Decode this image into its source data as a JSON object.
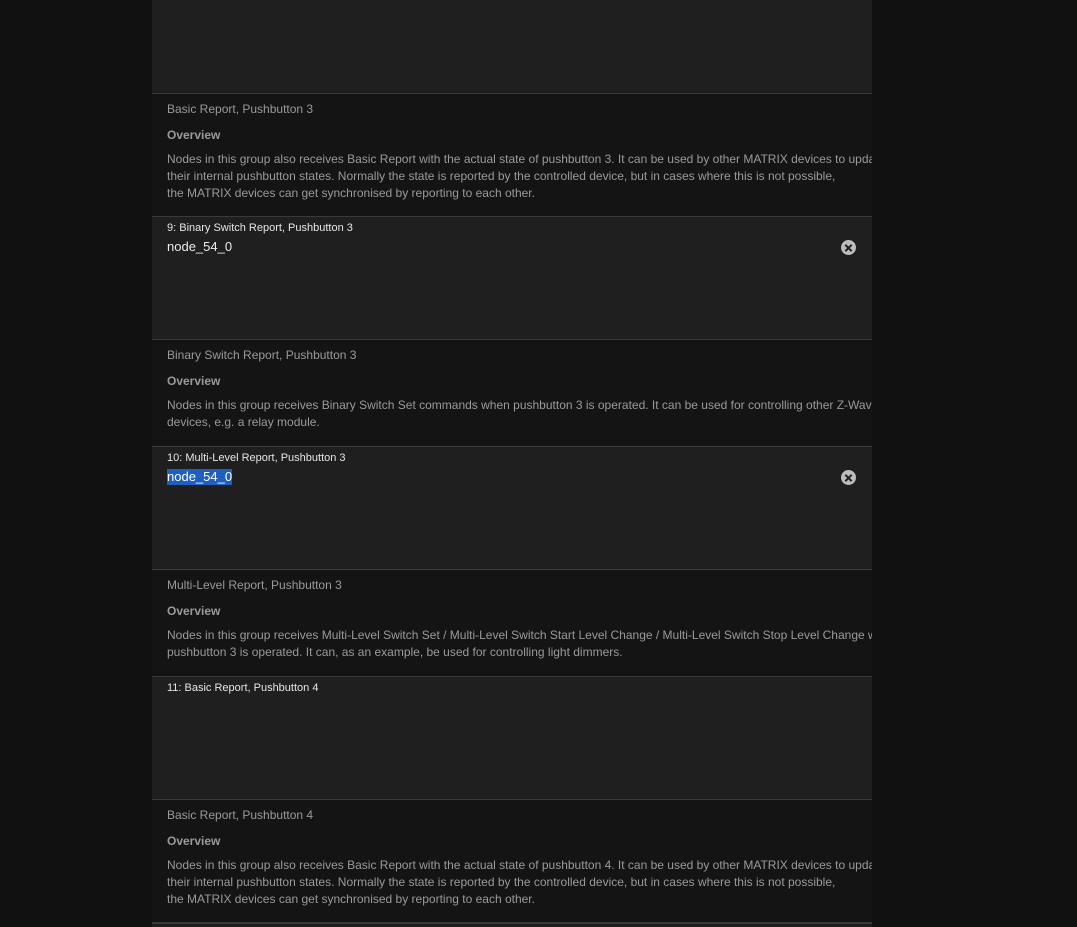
{
  "groups": [
    {
      "description": {
        "title": "Basic Report, Pushbutton 3",
        "overview_label": "Overview",
        "lines": [
          "Nodes in this group also receives Basic Report with the actual state of pushbutton 3. It can be used by other MATRIX devices to update",
          "their internal pushbutton states. Normally the state is reported by the controlled device, but in cases where this is not possible,",
          "the MATRIX devices can get synchronised by reporting to each other."
        ]
      }
    },
    {
      "association": {
        "title": "9: Binary Switch Report, Pushbutton 3",
        "nodes": [
          "node_54_0"
        ],
        "remove_icon": "close-circle-icon"
      },
      "description": {
        "title": "Binary Switch Report, Pushbutton 3",
        "overview_label": "Overview",
        "lines": [
          "Nodes in this group receives Binary Switch Set commands when pushbutton 3 is operated. It can be used for controlling other Z-Wave",
          "devices, e.g. a relay module."
        ]
      }
    },
    {
      "association": {
        "title": "10: Multi-Level Report, Pushbutton 3",
        "nodes": [
          "node_54_0"
        ],
        "remove_icon": "close-circle-icon",
        "selection_color": "#1f5fbf"
      },
      "description": {
        "title": "Multi-Level Report, Pushbutton 3",
        "overview_label": "Overview",
        "lines": [
          "Nodes in this group receives Multi-Level Switch Set / Multi-Level Switch Start Level Change / Multi-Level Switch Stop Level Change when",
          "pushbutton 3 is operated. It can, as an example, be used for controlling light dimmers."
        ]
      }
    },
    {
      "association": {
        "title": "11: Basic Report, Pushbutton 4",
        "nodes": []
      },
      "description": {
        "title": "Basic Report, Pushbutton 4",
        "overview_label": "Overview",
        "lines": [
          "Nodes in this group also receives Basic Report with the actual state of pushbutton 4. It can be used by other MATRIX devices to update",
          "their internal pushbutton states. Normally the state is reported by the controlled device, but in cases where this is not possible,",
          "the MATRIX devices can get synchronised by reporting to each other."
        ]
      }
    }
  ],
  "colors": {
    "page_background": "#111111",
    "association_background": "#1f1f1f",
    "description_background": "#141414",
    "divider": "#3a3a3a"
  }
}
